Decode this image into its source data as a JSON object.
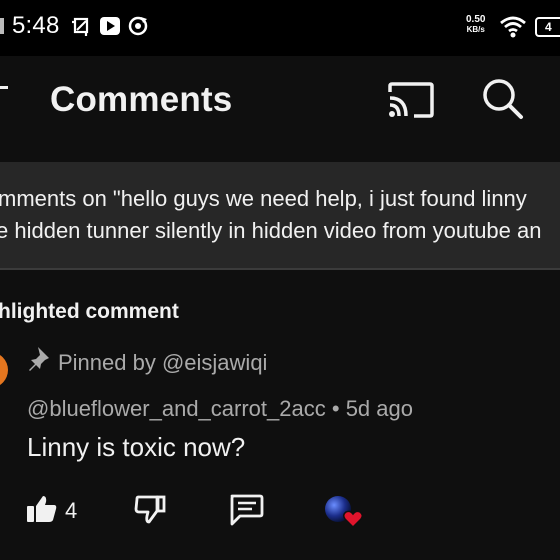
{
  "status_bar": {
    "time": "5:48",
    "net_speed_value": "0.50",
    "net_speed_unit": "KB/s",
    "battery": "4",
    "icons": [
      "screenshot-icon",
      "youtube-icon",
      "sync-icon",
      "wifi-icon"
    ]
  },
  "app_bar": {
    "title": "Comments",
    "icons": [
      "back-arrow-icon",
      "cast-icon",
      "search-icon"
    ]
  },
  "header": {
    "line1": "mments on \"hello guys we need help, i just found linny",
    "line2": "e hidden tunner silently in hidden video from youtube an"
  },
  "highlighted": {
    "section_title": "hlighted comment",
    "pinned_by": "Pinned by @eisjawiqi",
    "author": "@blueflower_and_carrot_2acc",
    "separator": "•",
    "age": "5d ago",
    "text": "Linny is toxic now?",
    "like_count": "4"
  },
  "colors": {
    "background": "#0f0f0f",
    "banner": "#272727",
    "secondary_text": "#aaaaaa",
    "heart": "#e0142c",
    "avatar": "#e4761f"
  }
}
